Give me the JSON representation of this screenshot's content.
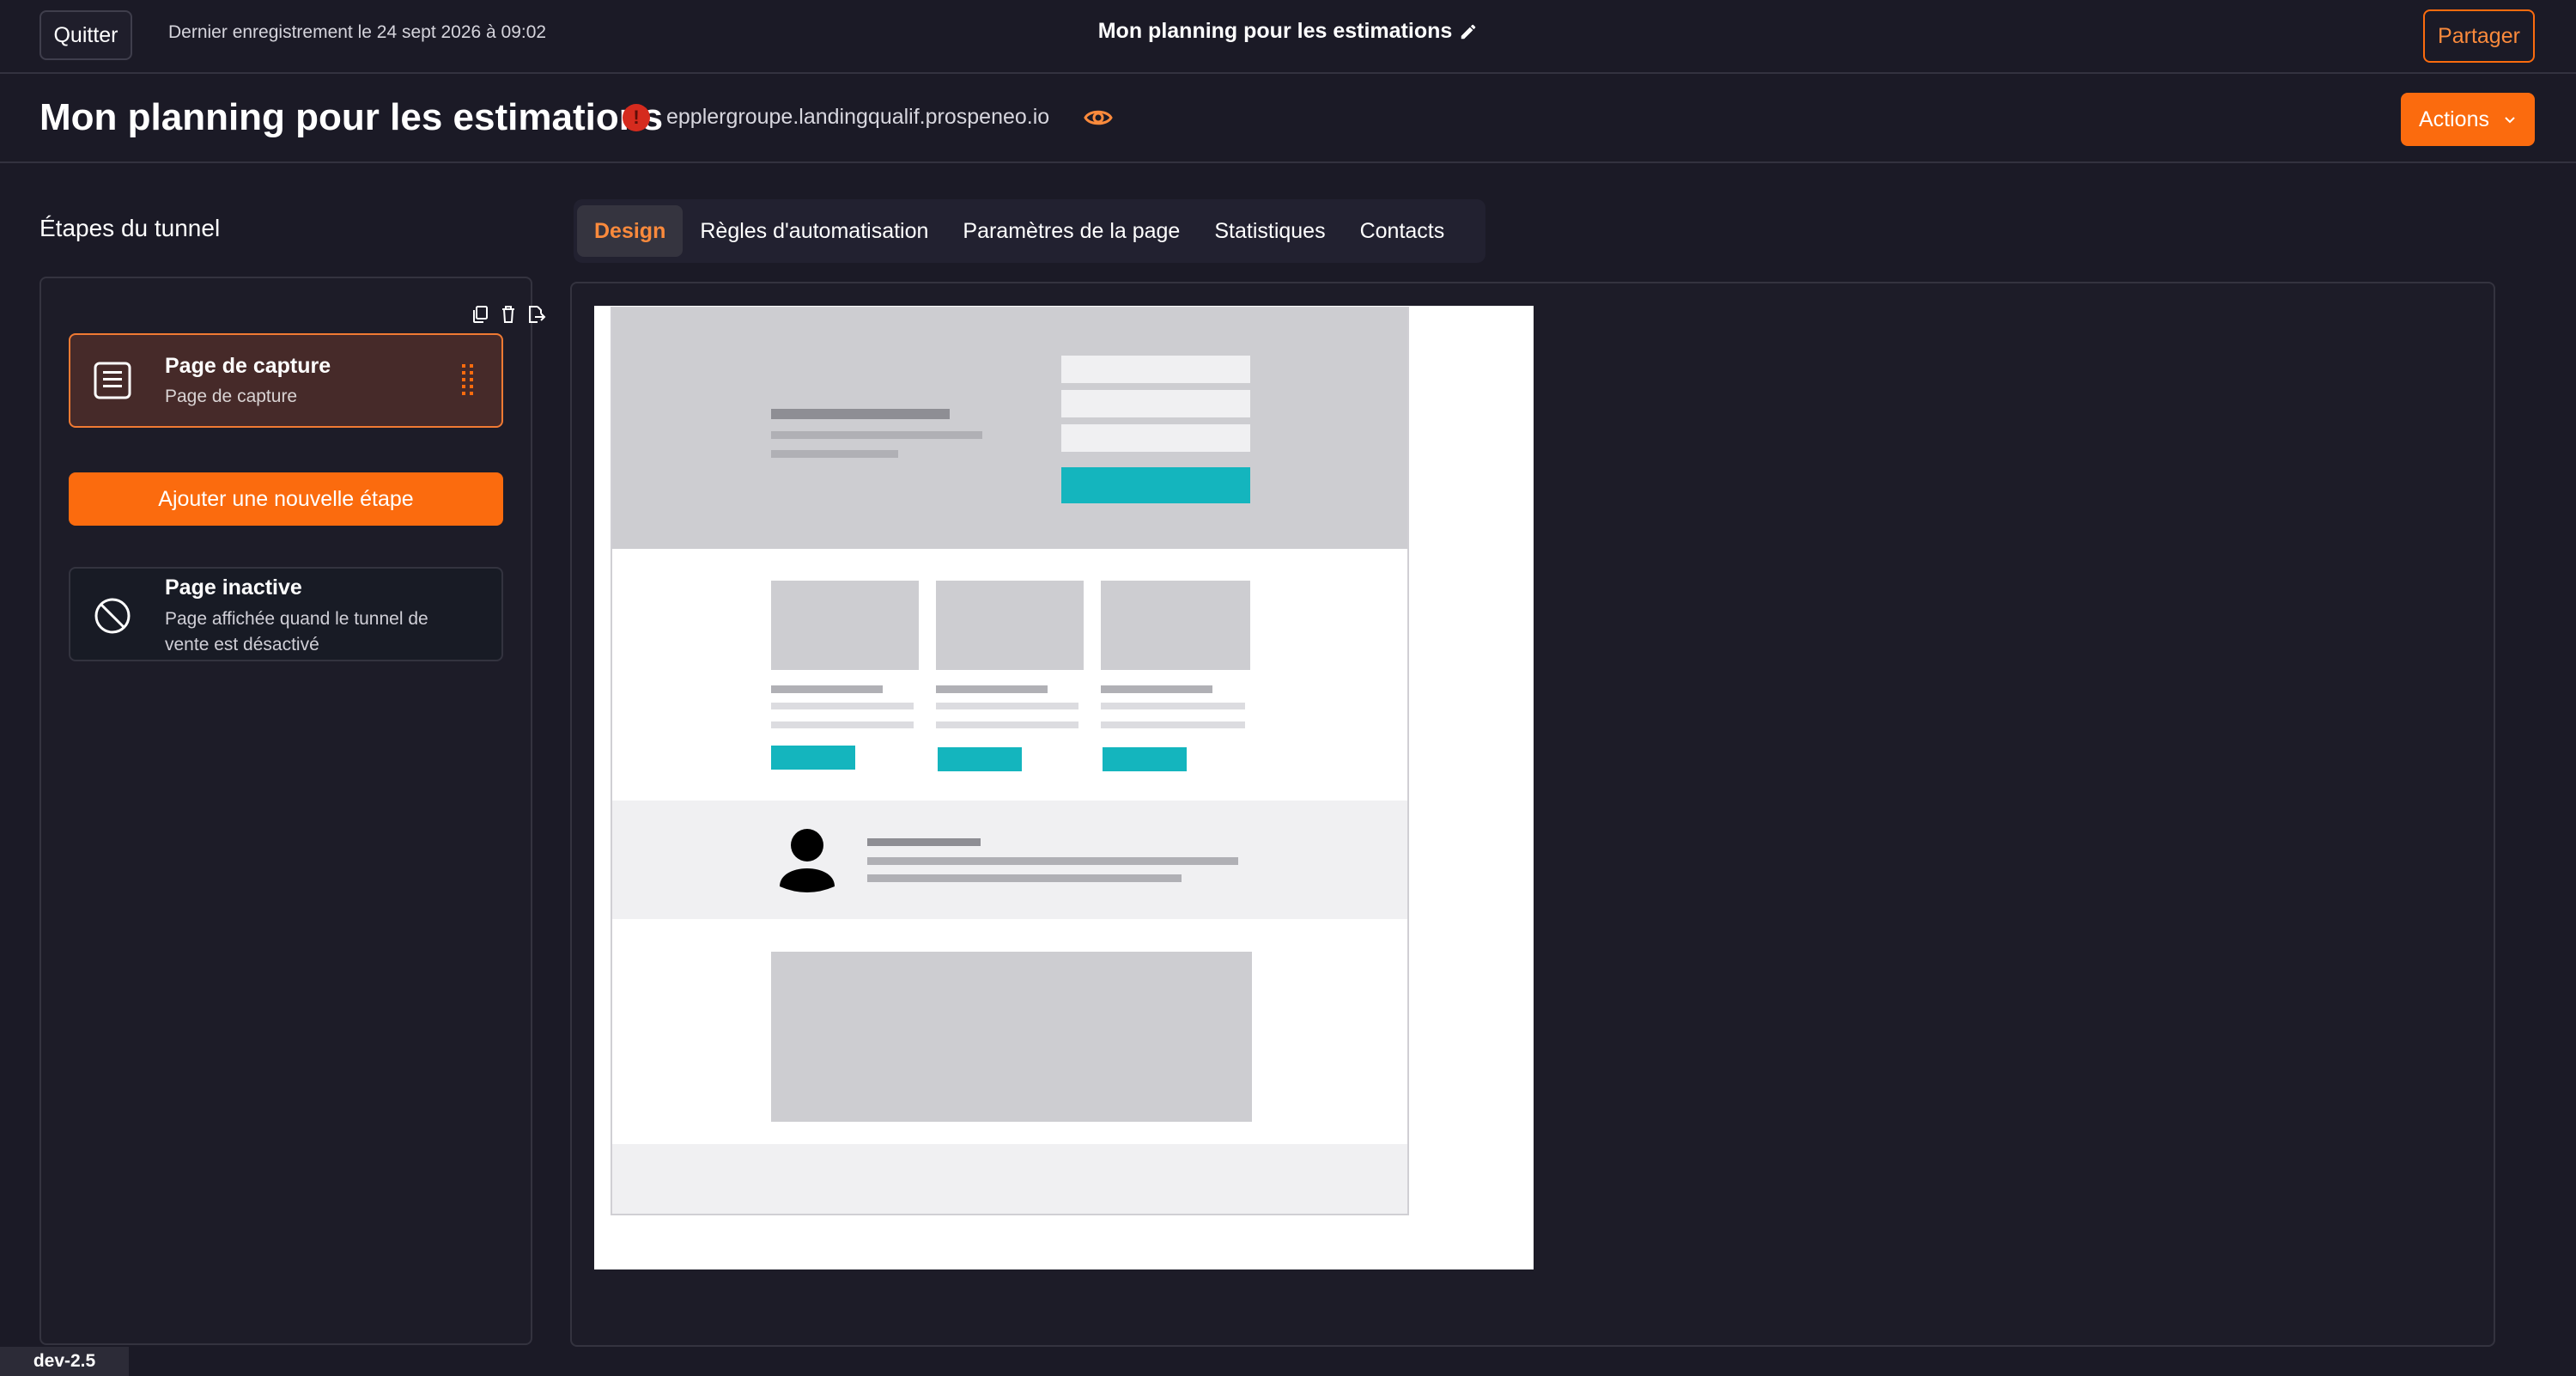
{
  "topbar": {
    "quit_label": "Quitter",
    "last_save": "Dernier enregistrement le 24 sept 2026 à 09:02",
    "title": "Mon planning pour les estimations",
    "share_label": "Partager"
  },
  "header": {
    "title": "Mon planning pour les estimations",
    "status_symbol": "!",
    "domain": "epplergroupe.landingqualif.prospeneo.io",
    "actions_label": "Actions"
  },
  "sidebar": {
    "title": "Étapes du tunnel",
    "steps": [
      {
        "name": "Page de capture",
        "type": "Page de capture"
      }
    ],
    "add_step_label": "Ajouter une nouvelle étape",
    "inactive": {
      "name": "Page inactive",
      "description": "Page affichée quand le tunnel de vente est désactivé"
    }
  },
  "tabs": [
    {
      "label": "Design",
      "active": true
    },
    {
      "label": "Règles d'automatisation",
      "active": false
    },
    {
      "label": "Paramètres de la page",
      "active": false
    },
    {
      "label": "Statistiques",
      "active": false
    },
    {
      "label": "Contacts",
      "active": false
    }
  ],
  "footer": {
    "version": "dev-2.5"
  },
  "colors": {
    "accent": "#fb6b0e",
    "background": "#1b1a26",
    "wire_accent": "#14b5be"
  },
  "icons": [
    "edit-pencil-icon",
    "eye-icon",
    "chevron-down-icon",
    "copy-icon",
    "trash-icon",
    "export-icon",
    "page-list-icon",
    "drag-handle-icon",
    "ban-icon",
    "user-avatar-icon"
  ]
}
